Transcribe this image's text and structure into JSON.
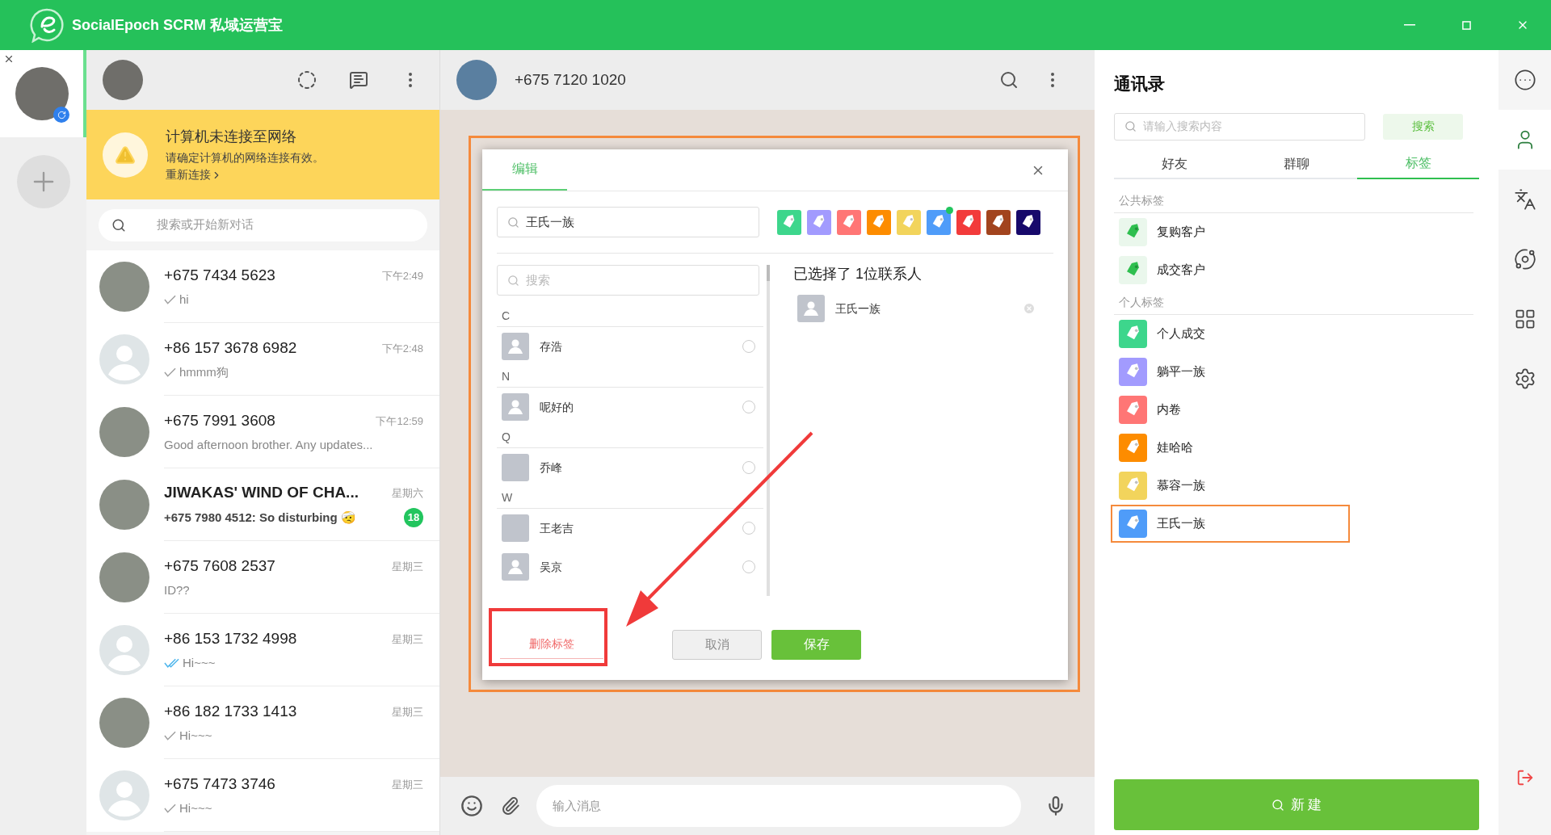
{
  "window": {
    "title": "SocialEpoch SCRM 私域运营宝"
  },
  "accounts": [
    {
      "selected": true
    }
  ],
  "chat_list": {
    "banner": {
      "title": "计算机未连接至网络",
      "text": "请确定计算机的网络连接有效。",
      "link": "重新连接"
    },
    "search_placeholder": "搜索或开始新对话",
    "chats": [
      {
        "name": "+675 7434 5623",
        "time": "下午2:49",
        "preview": "hi",
        "avatar": {
          "kind": "photo"
        },
        "receipt": {
          "kind": "sent"
        },
        "bold": false
      },
      {
        "name": "+86 157 3678 6982",
        "time": "下午2:48",
        "preview": "hmmm狗",
        "avatar": {
          "kind": "default"
        },
        "receipt": {
          "kind": "sent"
        },
        "bold": false
      },
      {
        "name": "+675 7991 3608",
        "time": "下午12:59",
        "preview": "Good afternoon brother. Any updates...",
        "avatar": {
          "kind": "photo"
        },
        "bold": false
      },
      {
        "name": "JIWAKAS' WIND OF CHA...",
        "time": "星期六",
        "preview": "+675 7980 4512: So disturbing 🤕",
        "avatar": {
          "kind": "photo"
        },
        "unread": "18",
        "bold": true
      },
      {
        "name": "+675 7608 2537",
        "time": "星期三",
        "preview": "ID??",
        "avatar": {
          "kind": "photo"
        },
        "bold": false
      },
      {
        "name": "+86 153 1732 4998",
        "time": "星期三",
        "preview": "Hi~~~",
        "avatar": {
          "kind": "default"
        },
        "receipt": {
          "kind": "read"
        },
        "bold": false
      },
      {
        "name": "+86 182 1733 1413",
        "time": "星期三",
        "preview": "Hi~~~",
        "avatar": {
          "kind": "photo"
        },
        "receipt": {
          "kind": "sent"
        },
        "bold": false
      },
      {
        "name": "+675 7473 3746",
        "time": "星期三",
        "preview": "Hi~~~",
        "avatar": {
          "kind": "default"
        },
        "receipt": {
          "kind": "sent"
        },
        "bold": false
      }
    ]
  },
  "conversation": {
    "name": "+675 7120 1020",
    "input_placeholder": "输入消息"
  },
  "dialog": {
    "tab": "编辑",
    "search_value": "王氏一族",
    "tag_colors": [
      {
        "color": "#3dd68c",
        "selected": false
      },
      {
        "color": "#a29bfe",
        "selected": false
      },
      {
        "color": "#ff7675",
        "selected": false
      },
      {
        "color": "#fd8c00",
        "selected": false
      },
      {
        "color": "#f2d45c",
        "selected": false
      },
      {
        "color": "#4f9cf9",
        "selected": true
      },
      {
        "color": "#f23b3b",
        "selected": false
      },
      {
        "color": "#a2441e",
        "selected": false
      },
      {
        "color": "#17096b",
        "selected": false
      }
    ],
    "list_search_placeholder": "搜索",
    "groups": [
      {
        "letter": "C",
        "contacts": [
          {
            "name": "存浩",
            "avatar": {
              "kind": "default"
            },
            "selected": false
          }
        ]
      },
      {
        "letter": "N",
        "contacts": [
          {
            "name": "呢好的",
            "avatar": {
              "kind": "default"
            },
            "selected": false
          }
        ]
      },
      {
        "letter": "Q",
        "contacts": [
          {
            "name": "乔峰",
            "avatar": {
              "kind": "blank"
            },
            "selected": false
          }
        ]
      },
      {
        "letter": "W",
        "contacts": [
          {
            "name": "王老吉",
            "avatar": {
              "kind": "blank"
            },
            "selected": false
          },
          {
            "name": "吴京",
            "avatar": {
              "kind": "default"
            },
            "selected": false
          }
        ]
      }
    ],
    "selected_title": "已选择了 1位联系人",
    "selected_contacts": [
      {
        "name": "王氏一族"
      }
    ],
    "delete_button": "删除标签",
    "cancel_button": "取消",
    "save_button": "保存"
  },
  "contacts": {
    "title": "通讯录",
    "search_placeholder": "请输入搜索内容",
    "search_button": "搜索",
    "tabs": [
      {
        "label": "好友",
        "selected": false
      },
      {
        "label": "群聊",
        "selected": false
      },
      {
        "label": "标签",
        "selected": true
      }
    ],
    "sections": [
      {
        "title": "公共标签",
        "kind": "public",
        "tags": [
          {
            "name": "复购客户",
            "color": "#2fbf4f",
            "highlighted": false
          },
          {
            "name": "成交客户",
            "color": "#2fbf4f",
            "highlighted": false
          }
        ]
      },
      {
        "title": "个人标签",
        "kind": "personal",
        "tags": [
          {
            "name": "个人成交",
            "color": "#3dd68c",
            "highlighted": false
          },
          {
            "name": "躺平一族",
            "color": "#a29bfe",
            "highlighted": false
          },
          {
            "name": "内卷",
            "color": "#ff7675",
            "highlighted": false
          },
          {
            "name": "娃哈哈",
            "color": "#fd8c00",
            "highlighted": false
          },
          {
            "name": "慕容一族",
            "color": "#f2d45c",
            "highlighted": false
          },
          {
            "name": "王氏一族",
            "color": "#4f9cf9",
            "highlighted": true
          }
        ]
      }
    ],
    "new_button": "新 建"
  },
  "rail": [
    {
      "kind": "more",
      "selected": false
    },
    {
      "kind": "person",
      "selected": true
    },
    {
      "kind": "translate",
      "selected": false
    },
    {
      "kind": "planet",
      "selected": false
    },
    {
      "kind": "apps",
      "selected": false
    },
    {
      "kind": "settings",
      "selected": false
    }
  ]
}
